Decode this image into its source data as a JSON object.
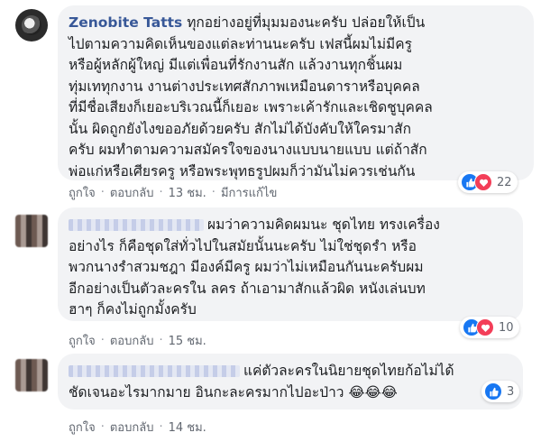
{
  "comments": [
    {
      "author": "Zenobite Tatts",
      "text": "ทุกอย่างอยู่ที่มุมมองนะครับ ปล่อยให้เป็น\nไปตามความคิดเห็นของแต่ละท่านนะครับ เฟสนี้ผมไม่มีครู\nหรือผู้หลักผู้ใหญ่ มีแต่เพื่อนที่รักงานสัก แล้วงานทุกชิ้นผม\nทุ่มเททุกงาน งานต่างประเทศสักภาพเหมือนดาราหรือบุคคล\nที่มีชื่อเสียงก็เยอะบริเวณนี้ก็เยอะ เพราะเค้ารักและเชิดชูบุคคล\nนั้น ผิดถูกยังไงขออภัยด้วยครับ สักไม่ได้บังคับให้ใครมาสัก\nครับ ผมทำตามความสมัครใจของนางแบบนายแบบ แต่ถ้าสัก\nพ่อแก่หรือเศียรครู หรือพระพุทธรูปผมก็ว่ามันไม่ควรเช่นกัน",
      "like": "ถูกใจ",
      "reply": "ตอบกลับ",
      "time": "13 ชม.",
      "edited": "มีการแก้ไข",
      "reaction_count": "22"
    },
    {
      "author": "",
      "text": "ผมว่าความคิดผมนะ ชุดไทย ทรงเครื่อง\nอย่างไร ก็คือชุดใส่ทั่วไปในสมัยนั้นนะครับ ไม่ใช่ชุดรำ หรือ\nพวกนางรำสวมชฎา มีองค์มีครู ผมว่าไม่เหมือนกันนะครับผม\nอีกอย่างเป็นตัวละครใน ลคร ถ้าเอามาสักแล้วผิด หนังเล่นบท\nฮาๆ ก็คงไม่ถูกมั้งครับ",
      "like": "ถูกใจ",
      "reply": "ตอบกลับ",
      "time": "15 ชม.",
      "reaction_count": "10"
    },
    {
      "author": "",
      "text": "แค่ตัวละครในนิยายชุดไทยก้อไม่ได้\nชัดเจนอะไรมากมาย อินกะละครมากไปอะป่าว 😂😂😂",
      "like": "ถูกใจ",
      "reply": "ตอบกลับ",
      "time": "14 ชม.",
      "reaction_count": "3"
    }
  ],
  "colors": {
    "author": "#385898",
    "bubble": "#f2f3f5",
    "like": "#1877f2",
    "love": "#f33e58"
  },
  "icons": {
    "like": "thumbs-up-icon",
    "love": "heart-icon"
  }
}
